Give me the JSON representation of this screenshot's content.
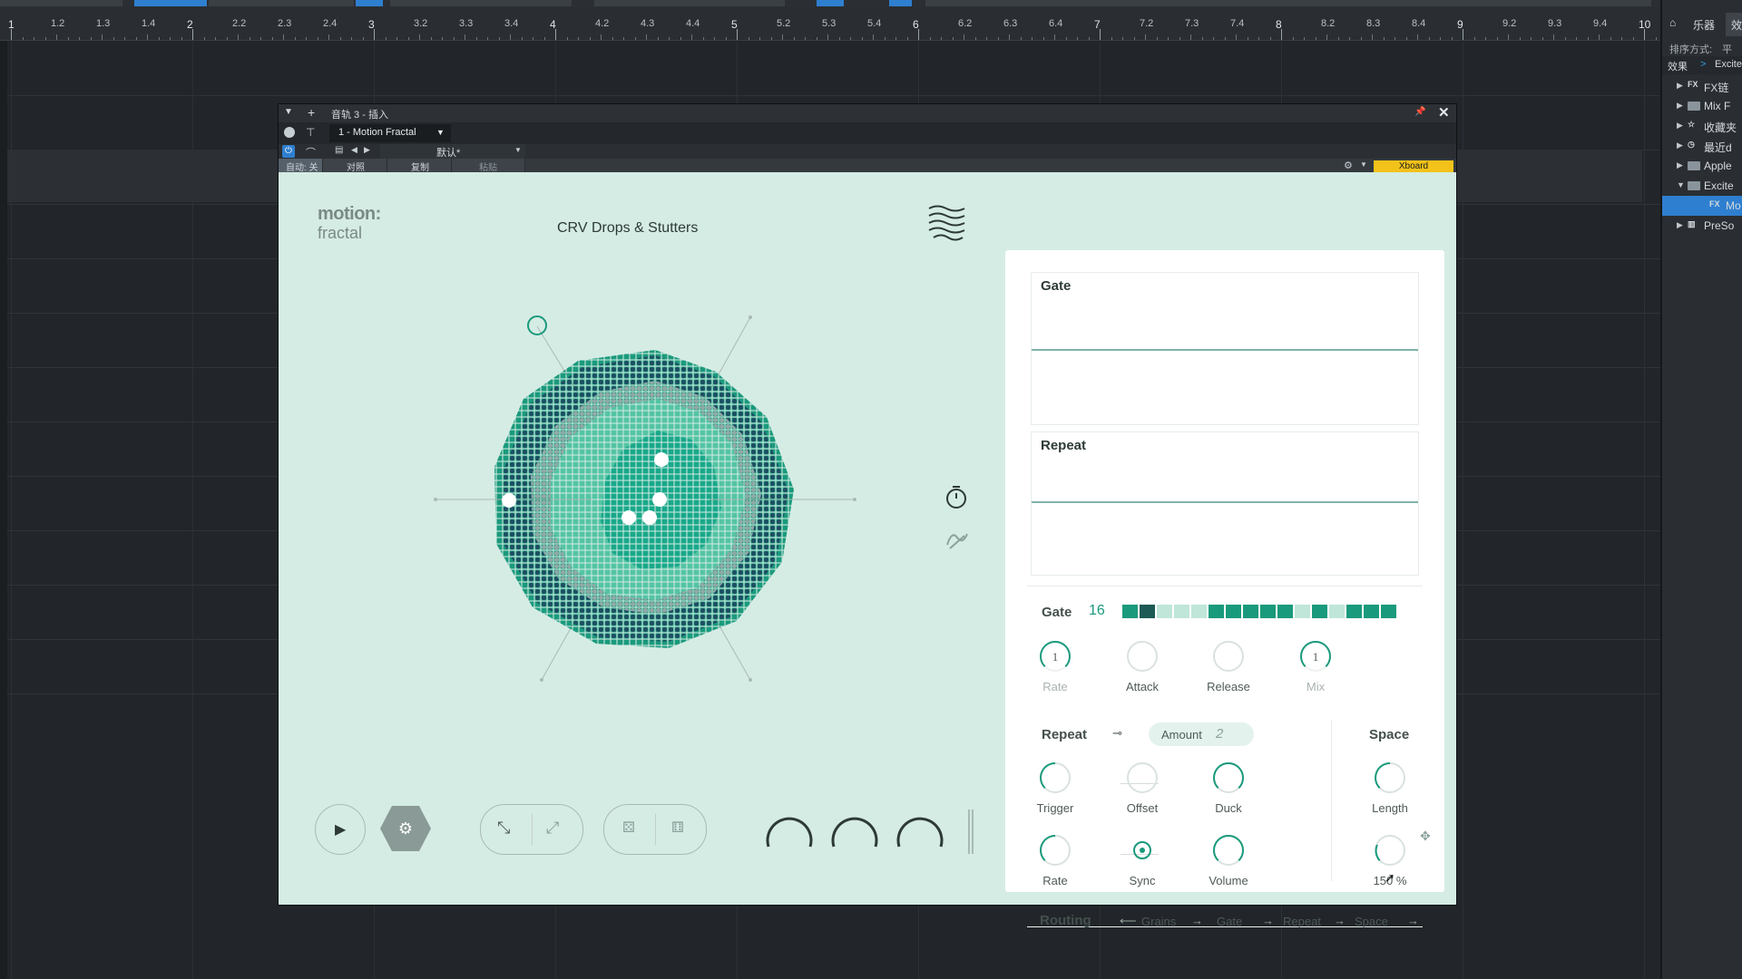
{
  "ruler": {
    "labels": [
      "1",
      "1.2",
      "1.3",
      "1.4",
      "2",
      "2.2",
      "2.3",
      "2.4",
      "3",
      "3.2",
      "3.3",
      "3.4",
      "4",
      "4.2",
      "4.3",
      "4.4",
      "5",
      "5.2",
      "5.3",
      "5.4",
      "6",
      "6.2",
      "6.3",
      "6.4",
      "7",
      "7.2",
      "7.3",
      "7.4",
      "8",
      "8.2",
      "8.3",
      "8.4",
      "9",
      "9.2",
      "9.3",
      "9.4",
      "10"
    ]
  },
  "browser": {
    "tabs": [
      "乐器",
      "效果"
    ],
    "sort_label": "排序方式:",
    "sort_value": "平",
    "breadcrumb_root": "效果",
    "breadcrumb_sep": ">",
    "breadcrumb_child": "Excite",
    "items": [
      {
        "label": "FX链",
        "icon": "fx-chain-icon"
      },
      {
        "label": "Mix F",
        "icon": "folder-icon"
      },
      {
        "label": "收藏夹",
        "icon": "star-icon"
      },
      {
        "label": "最近d",
        "icon": "clock-icon"
      },
      {
        "label": "Apple",
        "icon": "folder-icon"
      },
      {
        "label": "Excite",
        "icon": "folder-open-icon"
      },
      {
        "label": "Mo",
        "icon": "fx-icon",
        "selected": true
      },
      {
        "label": "PreSo",
        "icon": "piano-icon"
      }
    ]
  },
  "plugin_window": {
    "title": "音轨 3 - 插入",
    "preset": "1 - Motion Fractal",
    "preset_name_default": "默认*",
    "auto_label": "自动: 关",
    "compare_label": "对照",
    "copy_label": "复制",
    "paste_label": "粘贴",
    "xboard_label": "Xboard",
    "colors": {
      "accent": "#f2c21a",
      "titlebar": "#2d3135"
    }
  },
  "plugin": {
    "logo_line1": "motion:",
    "logo_line2": "fractal",
    "preset_name": "CRV Drops & Stutters",
    "colors": {
      "background": "#d5ece4",
      "panel": "#ffffff",
      "teal": "#1a9a7c",
      "dark_teal": "#1d4f63",
      "light": "#a9cec2"
    },
    "gate_env_title": "Gate",
    "repeat_env_title": "Repeat",
    "gate": {
      "label": "Gate",
      "steps_count": "16",
      "steps": [
        1,
        2,
        0,
        0,
        0,
        1,
        1,
        1,
        1,
        1,
        0,
        1,
        0,
        1,
        1,
        1
      ],
      "knobs": [
        {
          "label": "Rate",
          "value": "1",
          "dim": true
        },
        {
          "label": "Attack",
          "value": "",
          "dim": false
        },
        {
          "label": "Release",
          "value": "",
          "dim": false
        },
        {
          "label": "Mix",
          "value": "1",
          "dim": true
        }
      ]
    },
    "repeat": {
      "label": "Repeat",
      "amount_label": "Amount",
      "amount_value": "2",
      "row1": [
        {
          "label": "Trigger"
        },
        {
          "label": "Offset"
        },
        {
          "label": "Duck"
        }
      ],
      "row2": [
        {
          "label": "Rate"
        },
        {
          "label": "Sync"
        },
        {
          "label": "Volume"
        }
      ]
    },
    "space": {
      "label": "Space",
      "length_label": "Length",
      "value_text": "150 %"
    },
    "routing": {
      "label": "Routing",
      "items": [
        "Grains",
        "Gate",
        "Repeat",
        "Space"
      ]
    }
  }
}
